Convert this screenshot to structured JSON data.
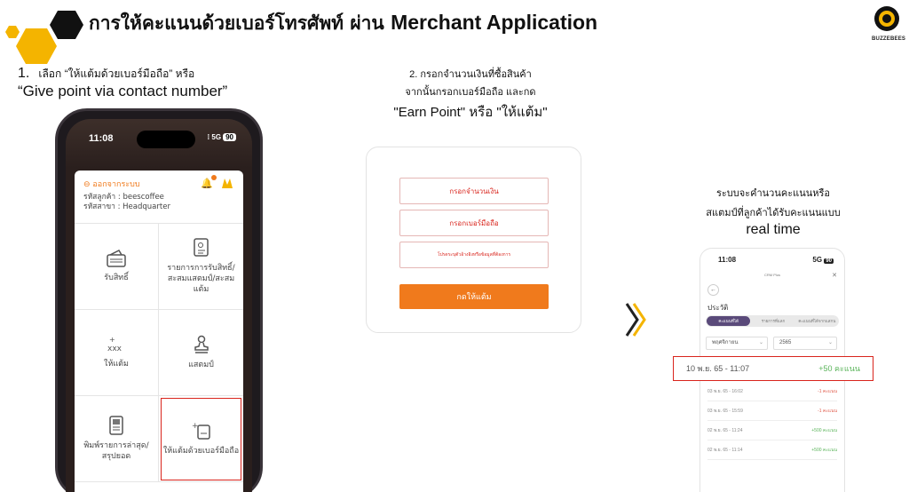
{
  "header": {
    "title_thai": "การให้คะแนนด้วยเบอร์โทรศัพท์ ผ่าน",
    "title_en": "Merchant Application",
    "logo_text": "BUZZEBEES"
  },
  "colors": {
    "accent": "#f07a1c",
    "hex_yellow": "#f4b400",
    "highlight": "#d9241c"
  },
  "step1": {
    "number": "1.",
    "line1": "เลือก “ให้แต้มด้วยเบอร์มือถือ” หรือ",
    "line2": "“Give point via contact number”"
  },
  "step2": {
    "line1": "2. กรอกจำนวนเงินที่ซื้อสินค้า",
    "line2": "จากนั้นกรอกเบอร์มือถือ และกด",
    "line3": "\"Earn Point\" หรือ \"ให้แต้ม\""
  },
  "step3": {
    "line1": "ระบบจะคำนวนคะแนนหรือ",
    "line2": "สแตมป์ที่ลูกค้าได้รับคะแนนแบบ",
    "line3": "real time"
  },
  "phone1": {
    "time": "11:08",
    "signal": "5G",
    "battery": "90",
    "logout": "ออกจากระบบ",
    "customer_code": "รหัสลูกค้า : beescoffee",
    "branch_code": "รหัสสาขา : Headquarter",
    "menu": [
      {
        "label": "รับสิทธิ์",
        "icon": "wallet-icon"
      },
      {
        "label": "รายการการรับสิทธิ์/สะสมแสตมป์/สะสมแต้ม",
        "icon": "document-icon"
      },
      {
        "label": "ให้แต้ม",
        "icon": "plus-xxx-icon"
      },
      {
        "label": "แสตมป์",
        "icon": "stamp-icon"
      },
      {
        "label": "พิมพ์รายการล่าสุด/สรุปยอด",
        "icon": "receipt-icon"
      },
      {
        "label": "ให้แต้มด้วยเบอร์มือถือ",
        "icon": "phone-points-icon"
      }
    ]
  },
  "form": {
    "amount_placeholder": "กรอกจำนวนเงิน",
    "phone_placeholder": "กรอกเบอร์มือถือ",
    "note_placeholder": "โปรดระบุตัวอ้างอิงหรือข้อมูลที่ต้องการ",
    "earn_button": "กดให้แต้ม"
  },
  "phone2": {
    "time": "11:08",
    "signal": "5G",
    "battery": "90",
    "app_name": "CRM Plus",
    "history_title": "ประวัติ",
    "tabs": [
      "คะแนนที่ได้",
      "รายการที่แลก",
      "คะแนนที่ได้จากแสกน"
    ],
    "month": "พฤศจิกายน",
    "year": "2565",
    "highlighted": {
      "date": "10 พ.ย. 65 - 11:07",
      "points": "+50 คะแนน"
    },
    "rows": [
      {
        "date": "03 พ.ย. 65 - 16:02",
        "points": "-1 คะแนน"
      },
      {
        "date": "03 พ.ย. 65 - 15:59",
        "points": "-1 คะแนน"
      },
      {
        "date": "02 พ.ย. 65 - 11:24",
        "points": "+500 คะแนน"
      },
      {
        "date": "02 พ.ย. 65 - 11:14",
        "points": "+500 คะแนน"
      }
    ]
  }
}
